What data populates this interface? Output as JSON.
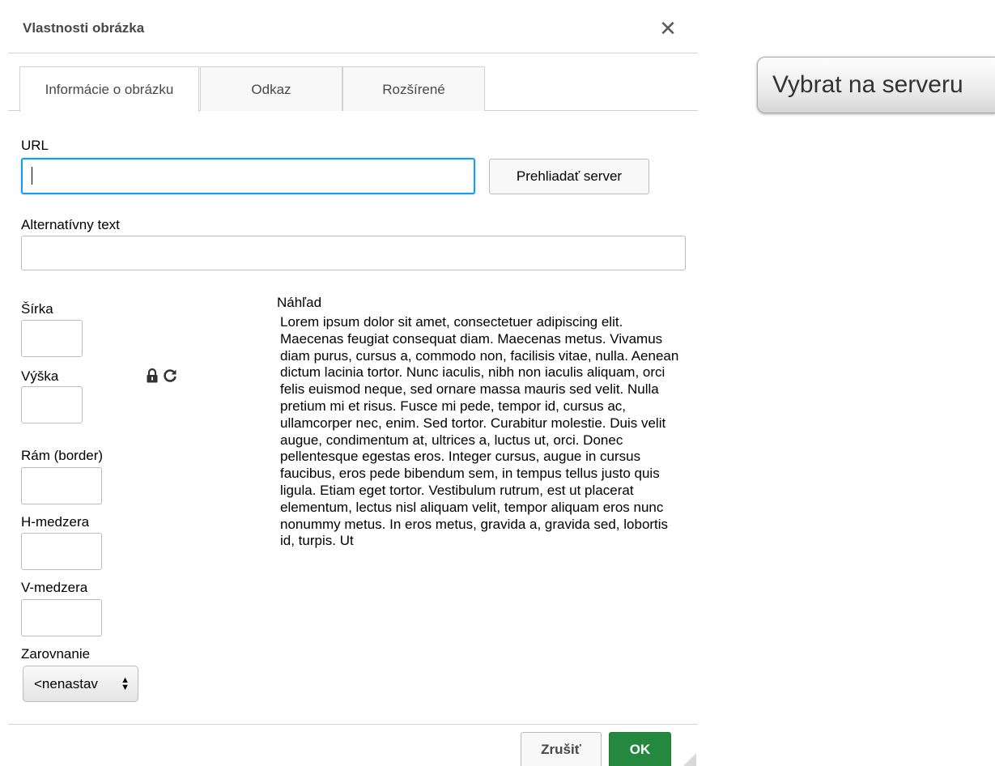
{
  "dialog": {
    "title": "Vlastnosti obrázka",
    "close_symbol": "✕",
    "tabs": [
      {
        "label": "Informácie o obrázku",
        "active": true
      },
      {
        "label": "Odkaz",
        "active": false
      },
      {
        "label": "Rozšírené",
        "active": false
      }
    ],
    "url": {
      "label": "URL",
      "value": ""
    },
    "browse_button": "Prehliadať server",
    "alt_text": {
      "label": "Alternatívny text",
      "value": ""
    },
    "width": {
      "label": "Šírka",
      "value": ""
    },
    "height": {
      "label": "Výška",
      "value": ""
    },
    "border": {
      "label": "Rám (border)",
      "value": ""
    },
    "hspace": {
      "label": "H-medzera",
      "value": ""
    },
    "vspace": {
      "label": "V-medzera",
      "value": ""
    },
    "align": {
      "label": "Zarovnanie",
      "selected": "<nenastav"
    },
    "preview": {
      "label": "Náhľad",
      "text": "Lorem ipsum dolor sit amet, consectetuer adipiscing elit. Maecenas feugiat consequat diam. Maecenas metus. Vivamus diam purus, cursus a, commodo non, facilisis vitae, nulla. Aenean dictum lacinia tortor. Nunc iaculis, nibh non iaculis aliquam, orci felis euismod neque, sed ornare massa mauris sed velit. Nulla pretium mi et risus. Fusce mi pede, tempor id, cursus ac, ullamcorper nec, enim. Sed tortor. Curabitur molestie. Duis velit augue, condimentum at, ultrices a, luctus ut, orci. Donec pellentesque egestas eros. Integer cursus, augue in cursus faucibus, eros pede bibendum sem, in tempus tellus justo quis ligula. Etiam eget tortor. Vestibulum rutrum, est ut placerat elementum, lectus nisl aliquam velit, tempor aliquam eros nunc nonummy metus. In eros metus, gravida a, gravida sed, lobortis id, turpis. Ut"
    },
    "cancel_button": "Zrušiť",
    "ok_button": "OK"
  },
  "server_button": "Vybrat na serveru",
  "colors": {
    "ok_green": "#24883e",
    "focus_blue": "#139ff7",
    "border_gray": "#bcbcbc"
  },
  "icons": {
    "close": "close-icon",
    "lock": "lock-icon",
    "reset": "reset-size-icon",
    "select_arrows": "select-arrows-icon",
    "resize": "resize-grip-icon"
  }
}
